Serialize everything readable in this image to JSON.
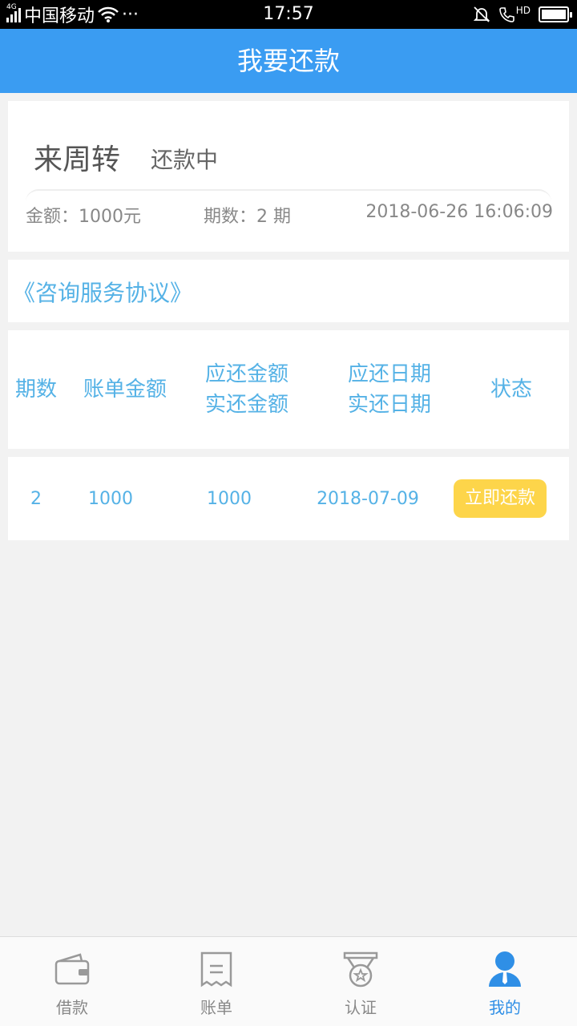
{
  "status_bar": {
    "network_tag": "4G",
    "carrier": "中国移动",
    "more": "···",
    "time": "17:57",
    "hd_tag": "HD"
  },
  "header": {
    "title": "我要还款"
  },
  "loan": {
    "name": "来周转",
    "status": "还款中",
    "amount": "金额：1000元",
    "periods": "期数：2 期",
    "time": "2018-06-26 16:06:09"
  },
  "agreement": {
    "link_text": "《咨询服务协议》"
  },
  "table": {
    "headers": {
      "period": "期数",
      "bill_amount": "账单金额",
      "due_amount": "应还金额",
      "paid_amount": "实还金额",
      "due_date": "应还日期",
      "paid_date": "实还日期",
      "status": "状态"
    },
    "rows": [
      {
        "period": "2",
        "bill_amount": "1000",
        "due_amount": "1000",
        "due_date": "2018-07-09",
        "action": "立即还款"
      }
    ]
  },
  "colors": {
    "accent": "#3a9cf2",
    "link": "#55b2e6",
    "pay_button": "#fdd54a"
  },
  "tabs": [
    {
      "label": "借款",
      "icon": "wallet-icon"
    },
    {
      "label": "账单",
      "icon": "bill-icon"
    },
    {
      "label": "认证",
      "icon": "medal-icon"
    },
    {
      "label": "我的",
      "icon": "user-icon",
      "active": true
    }
  ]
}
